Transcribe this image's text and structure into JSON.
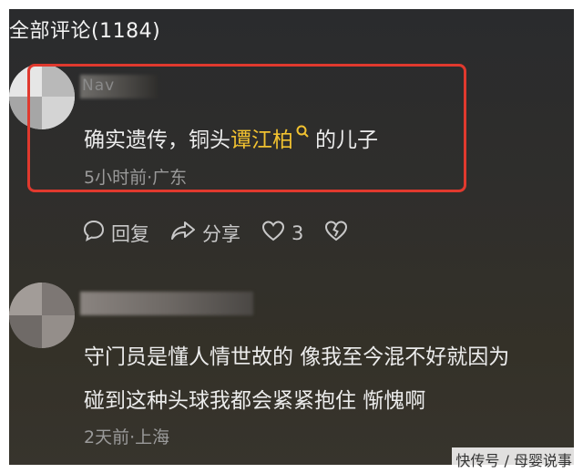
{
  "header": {
    "title": "全部评论(1184)"
  },
  "comments": [
    {
      "username_partial": "Nav",
      "text_before": "确实遗传，铜头",
      "highlight": "谭江柏",
      "text_after": "的儿子",
      "meta": "5小时前·广东",
      "actions": {
        "reply": "回复",
        "share": "分享",
        "like_count": "3"
      }
    },
    {
      "line1": "守门员是懂人情世故的 像我至今混不好就因为",
      "line2": "碰到这种头球我都会紧紧抱住 惭愧啊",
      "meta": "2天前·上海"
    }
  ],
  "watermark": "快传号 / 母婴说事",
  "colors": {
    "highlight": "#f2c230",
    "box_border": "#e0392e",
    "background": "#2f2e2c"
  },
  "icons": [
    "search-icon",
    "comment-bubble-icon",
    "share-arrow-icon",
    "heart-icon",
    "broken-heart-icon"
  ]
}
